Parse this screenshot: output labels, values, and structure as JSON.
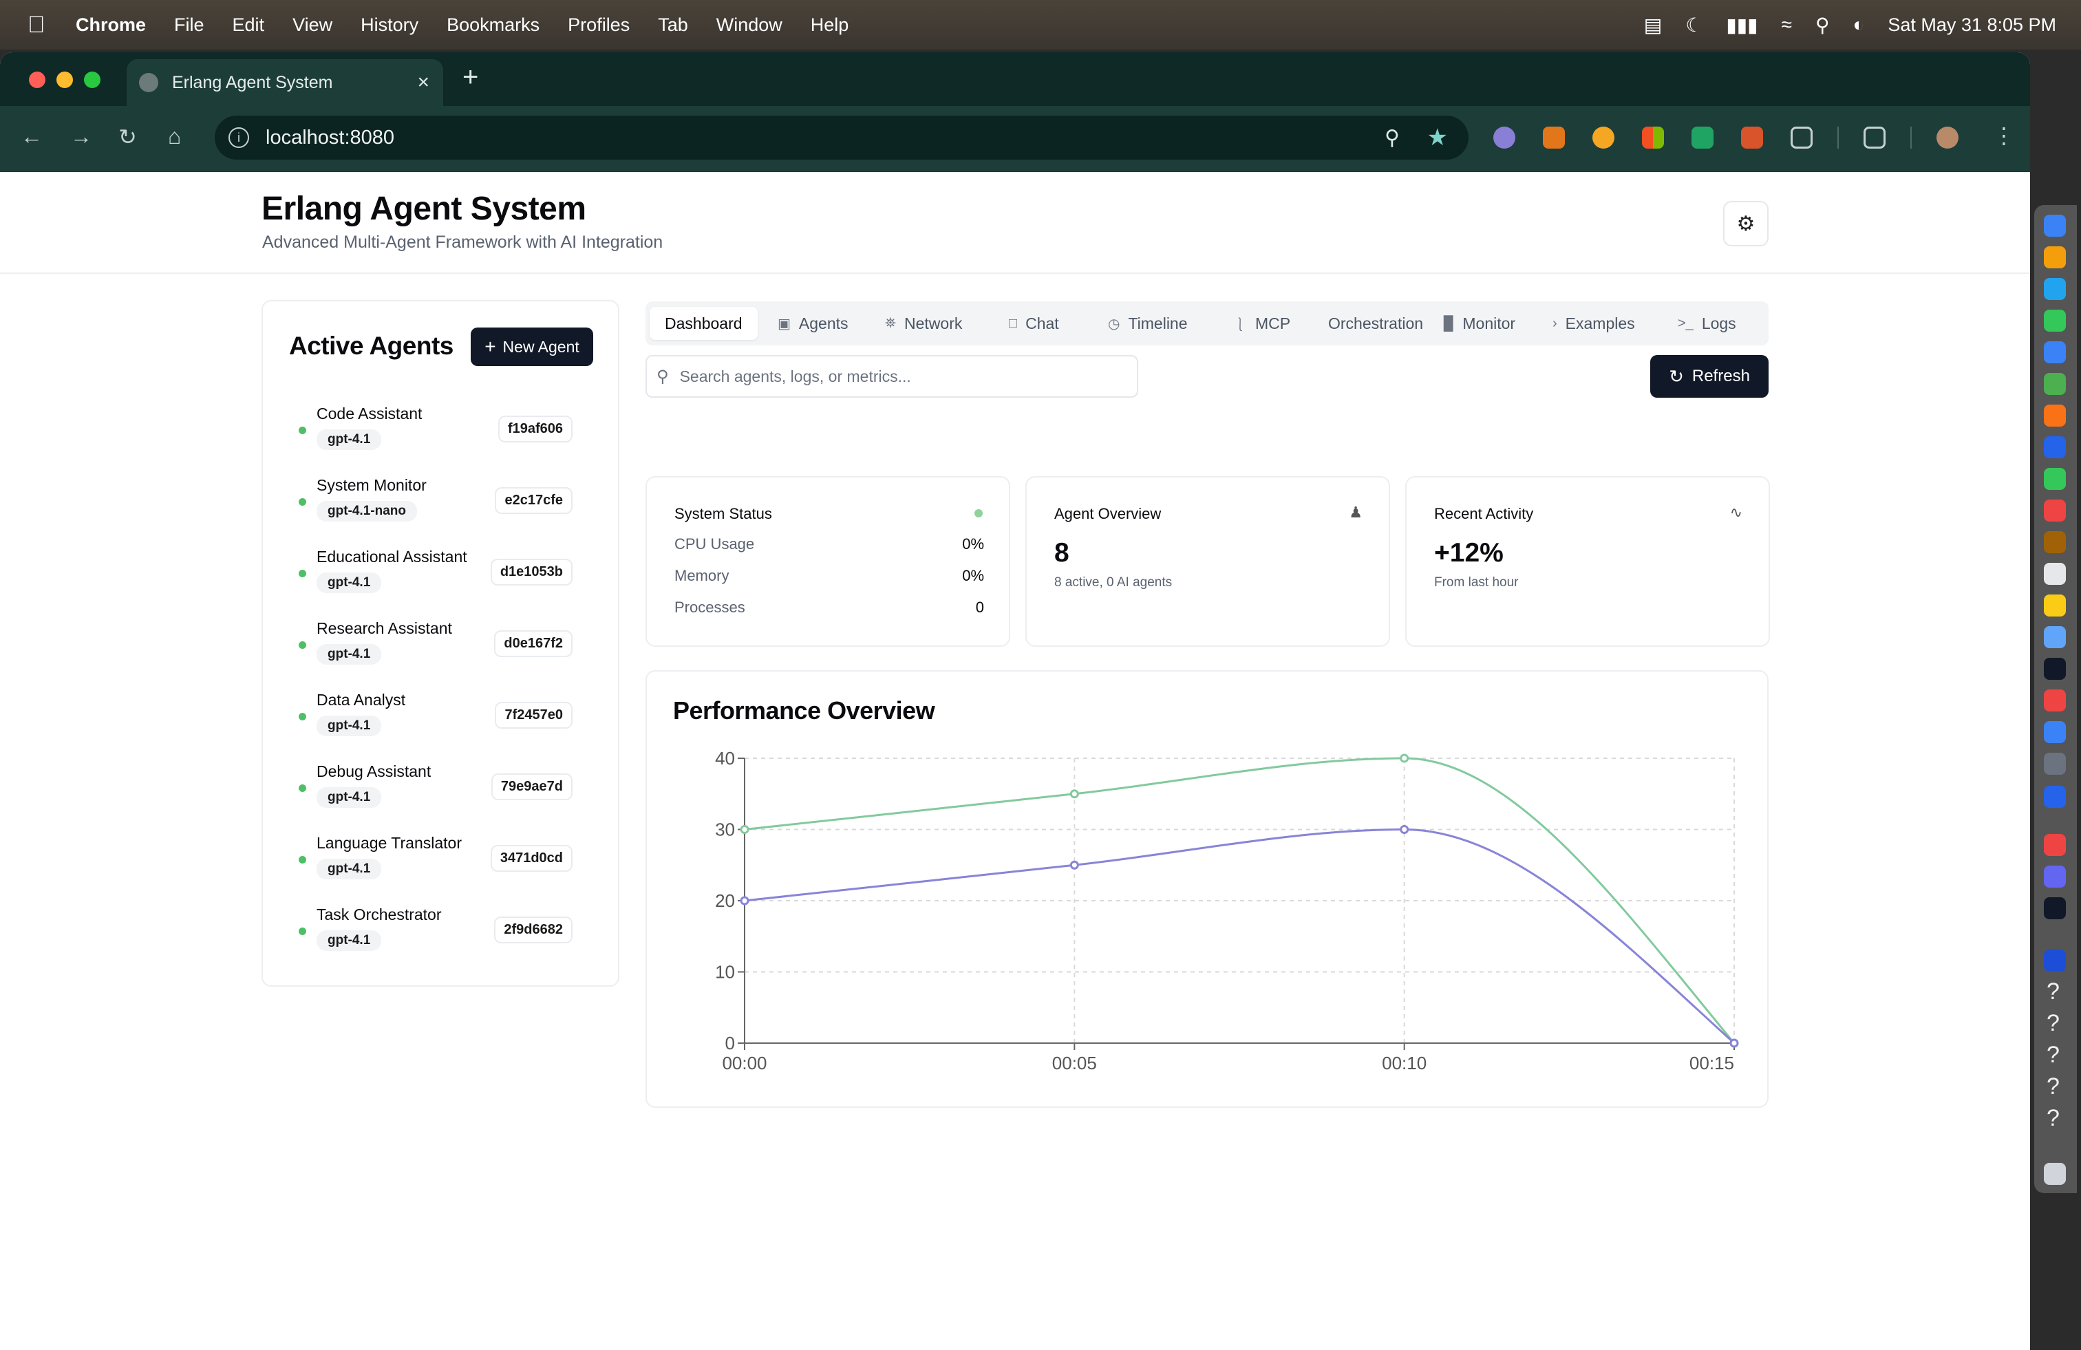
{
  "menubar": {
    "app": "Chrome",
    "items": [
      "File",
      "Edit",
      "View",
      "History",
      "Bookmarks",
      "Profiles",
      "Tab",
      "Window",
      "Help"
    ],
    "datetime": "Sat May 31  8:05 PM"
  },
  "browser": {
    "tab_title": "Erlang Agent System",
    "url": "localhost:8080"
  },
  "app": {
    "title": "Erlang Agent System",
    "subtitle": "Advanced Multi-Agent Framework with AI Integration"
  },
  "agents_panel": {
    "title": "Active Agents",
    "new_button": "New Agent",
    "agents": [
      {
        "name": "Code Assistant",
        "model": "gpt-4.1",
        "id": "f19af606"
      },
      {
        "name": "System Monitor",
        "model": "gpt-4.1-nano",
        "id": "e2c17cfe"
      },
      {
        "name": "Educational Assistant",
        "model": "gpt-4.1",
        "id": "d1e1053b"
      },
      {
        "name": "Research Assistant",
        "model": "gpt-4.1",
        "id": "d0e167f2"
      },
      {
        "name": "Data Analyst",
        "model": "gpt-4.1",
        "id": "7f2457e0"
      },
      {
        "name": "Debug Assistant",
        "model": "gpt-4.1",
        "id": "79e9ae7d"
      },
      {
        "name": "Language Translator",
        "model": "gpt-4.1",
        "id": "3471d0cd"
      },
      {
        "name": "Task Orchestrator",
        "model": "gpt-4.1",
        "id": "2f9d6682"
      }
    ]
  },
  "tabs": [
    {
      "label": "Dashboard",
      "icon": ""
    },
    {
      "label": "Agents",
      "icon": "bot-icon"
    },
    {
      "label": "Network",
      "icon": "network-icon"
    },
    {
      "label": "Chat",
      "icon": "chat-icon"
    },
    {
      "label": "Timeline",
      "icon": "clock-icon"
    },
    {
      "label": "MCP",
      "icon": "plug-icon"
    },
    {
      "label": "Orchestration",
      "icon": ""
    },
    {
      "label": "Monitor",
      "icon": "bar-chart-icon"
    },
    {
      "label": "Examples",
      "icon": "chevron-right-icon"
    },
    {
      "label": "Logs",
      "icon": "terminal-icon"
    }
  ],
  "search": {
    "placeholder": "Search agents, logs, or metrics..."
  },
  "refresh_label": "Refresh",
  "system_status": {
    "title": "System Status",
    "cpu_label": "CPU Usage",
    "cpu_value": "0%",
    "memory_label": "Memory",
    "memory_value": "0%",
    "processes_label": "Processes",
    "processes_value": "0"
  },
  "agent_overview": {
    "title": "Agent Overview",
    "value": "8",
    "detail": "8 active, 0 AI agents"
  },
  "recent_activity": {
    "title": "Recent Activity",
    "value": "+12%",
    "detail": "From last hour"
  },
  "performance": {
    "title": "Performance Overview"
  },
  "colors": {
    "green_series": "#82ca9d",
    "purple_series": "#8884d8",
    "button_dark": "#111827"
  },
  "chart_data": {
    "type": "line",
    "title": "Performance Overview",
    "x": [
      "00:00",
      "00:05",
      "00:10",
      "00:15"
    ],
    "ylim": [
      0,
      40
    ],
    "yticks": [
      0,
      10,
      20,
      30,
      40
    ],
    "grid": true,
    "series": [
      {
        "values": [
          30,
          35,
          40,
          0
        ],
        "color": "#82ca9d"
      },
      {
        "values": [
          20,
          25,
          30,
          0
        ],
        "color": "#8884d8"
      }
    ]
  }
}
